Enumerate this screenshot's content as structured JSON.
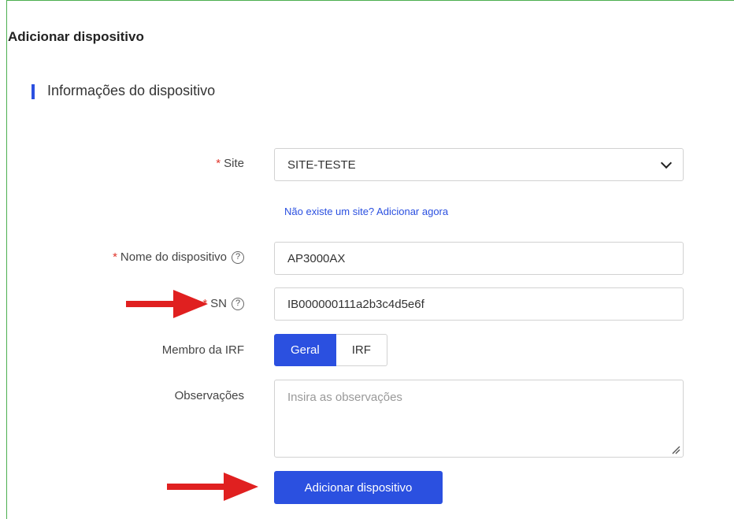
{
  "page": {
    "title": "Adicionar dispositivo"
  },
  "section": {
    "title": "Informações do dispositivo"
  },
  "form": {
    "site": {
      "label": "Site",
      "value": "SITE-TESTE",
      "required": true
    },
    "add_site_link": "Não existe um site? Adicionar agora",
    "device_name": {
      "label": "Nome do dispositivo",
      "value": "AP3000AX",
      "required": true
    },
    "sn": {
      "label": "SN",
      "value": "IB000000111a2b3c4d5e6f",
      "required": true
    },
    "irf_member": {
      "label": "Membro da IRF",
      "options": [
        "Geral",
        "IRF"
      ],
      "selected": "Geral"
    },
    "notes": {
      "label": "Observações",
      "placeholder": "Insira as observações"
    },
    "submit_label": "Adicionar dispositivo",
    "required_mark": "*",
    "help_glyph": "?"
  },
  "colors": {
    "accent": "#2b50e0",
    "required": "#e0352b",
    "annotation_arrow": "#e02020",
    "frame": "#4caf50"
  }
}
